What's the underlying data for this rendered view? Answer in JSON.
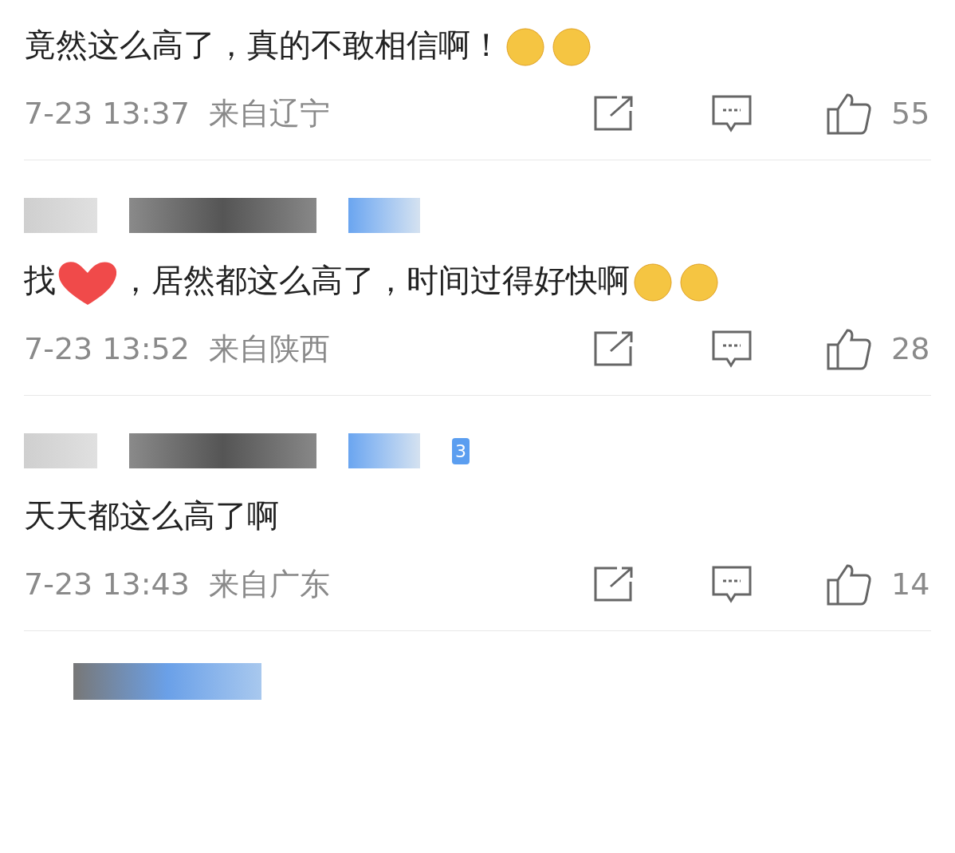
{
  "comments": [
    {
      "name_hidden": false,
      "segments": [
        {
          "kind": "text",
          "text": "竟然这么高了，真的不敢相信啊！"
        },
        {
          "kind": "emoji"
        },
        {
          "kind": "emoji"
        }
      ],
      "time": "7-23 13:37",
      "location": "来自辽宁",
      "likes": "55"
    },
    {
      "name_hidden": true,
      "segments": [
        {
          "kind": "text",
          "text": "找"
        },
        {
          "kind": "sticker"
        },
        {
          "kind": "text",
          "text": "，居然都这么高了，时间过得好快啊"
        },
        {
          "kind": "emoji"
        },
        {
          "kind": "emoji"
        }
      ],
      "time": "7-23 13:52",
      "location": "来自陕西",
      "likes": "28"
    },
    {
      "name_hidden": true,
      "badge": "3",
      "segments": [
        {
          "kind": "text",
          "text": "天天都这么高了啊"
        }
      ],
      "time": "7-23 13:43",
      "location": "来自广东",
      "likes": "14"
    }
  ],
  "next_comment": {
    "name_hidden": true
  }
}
